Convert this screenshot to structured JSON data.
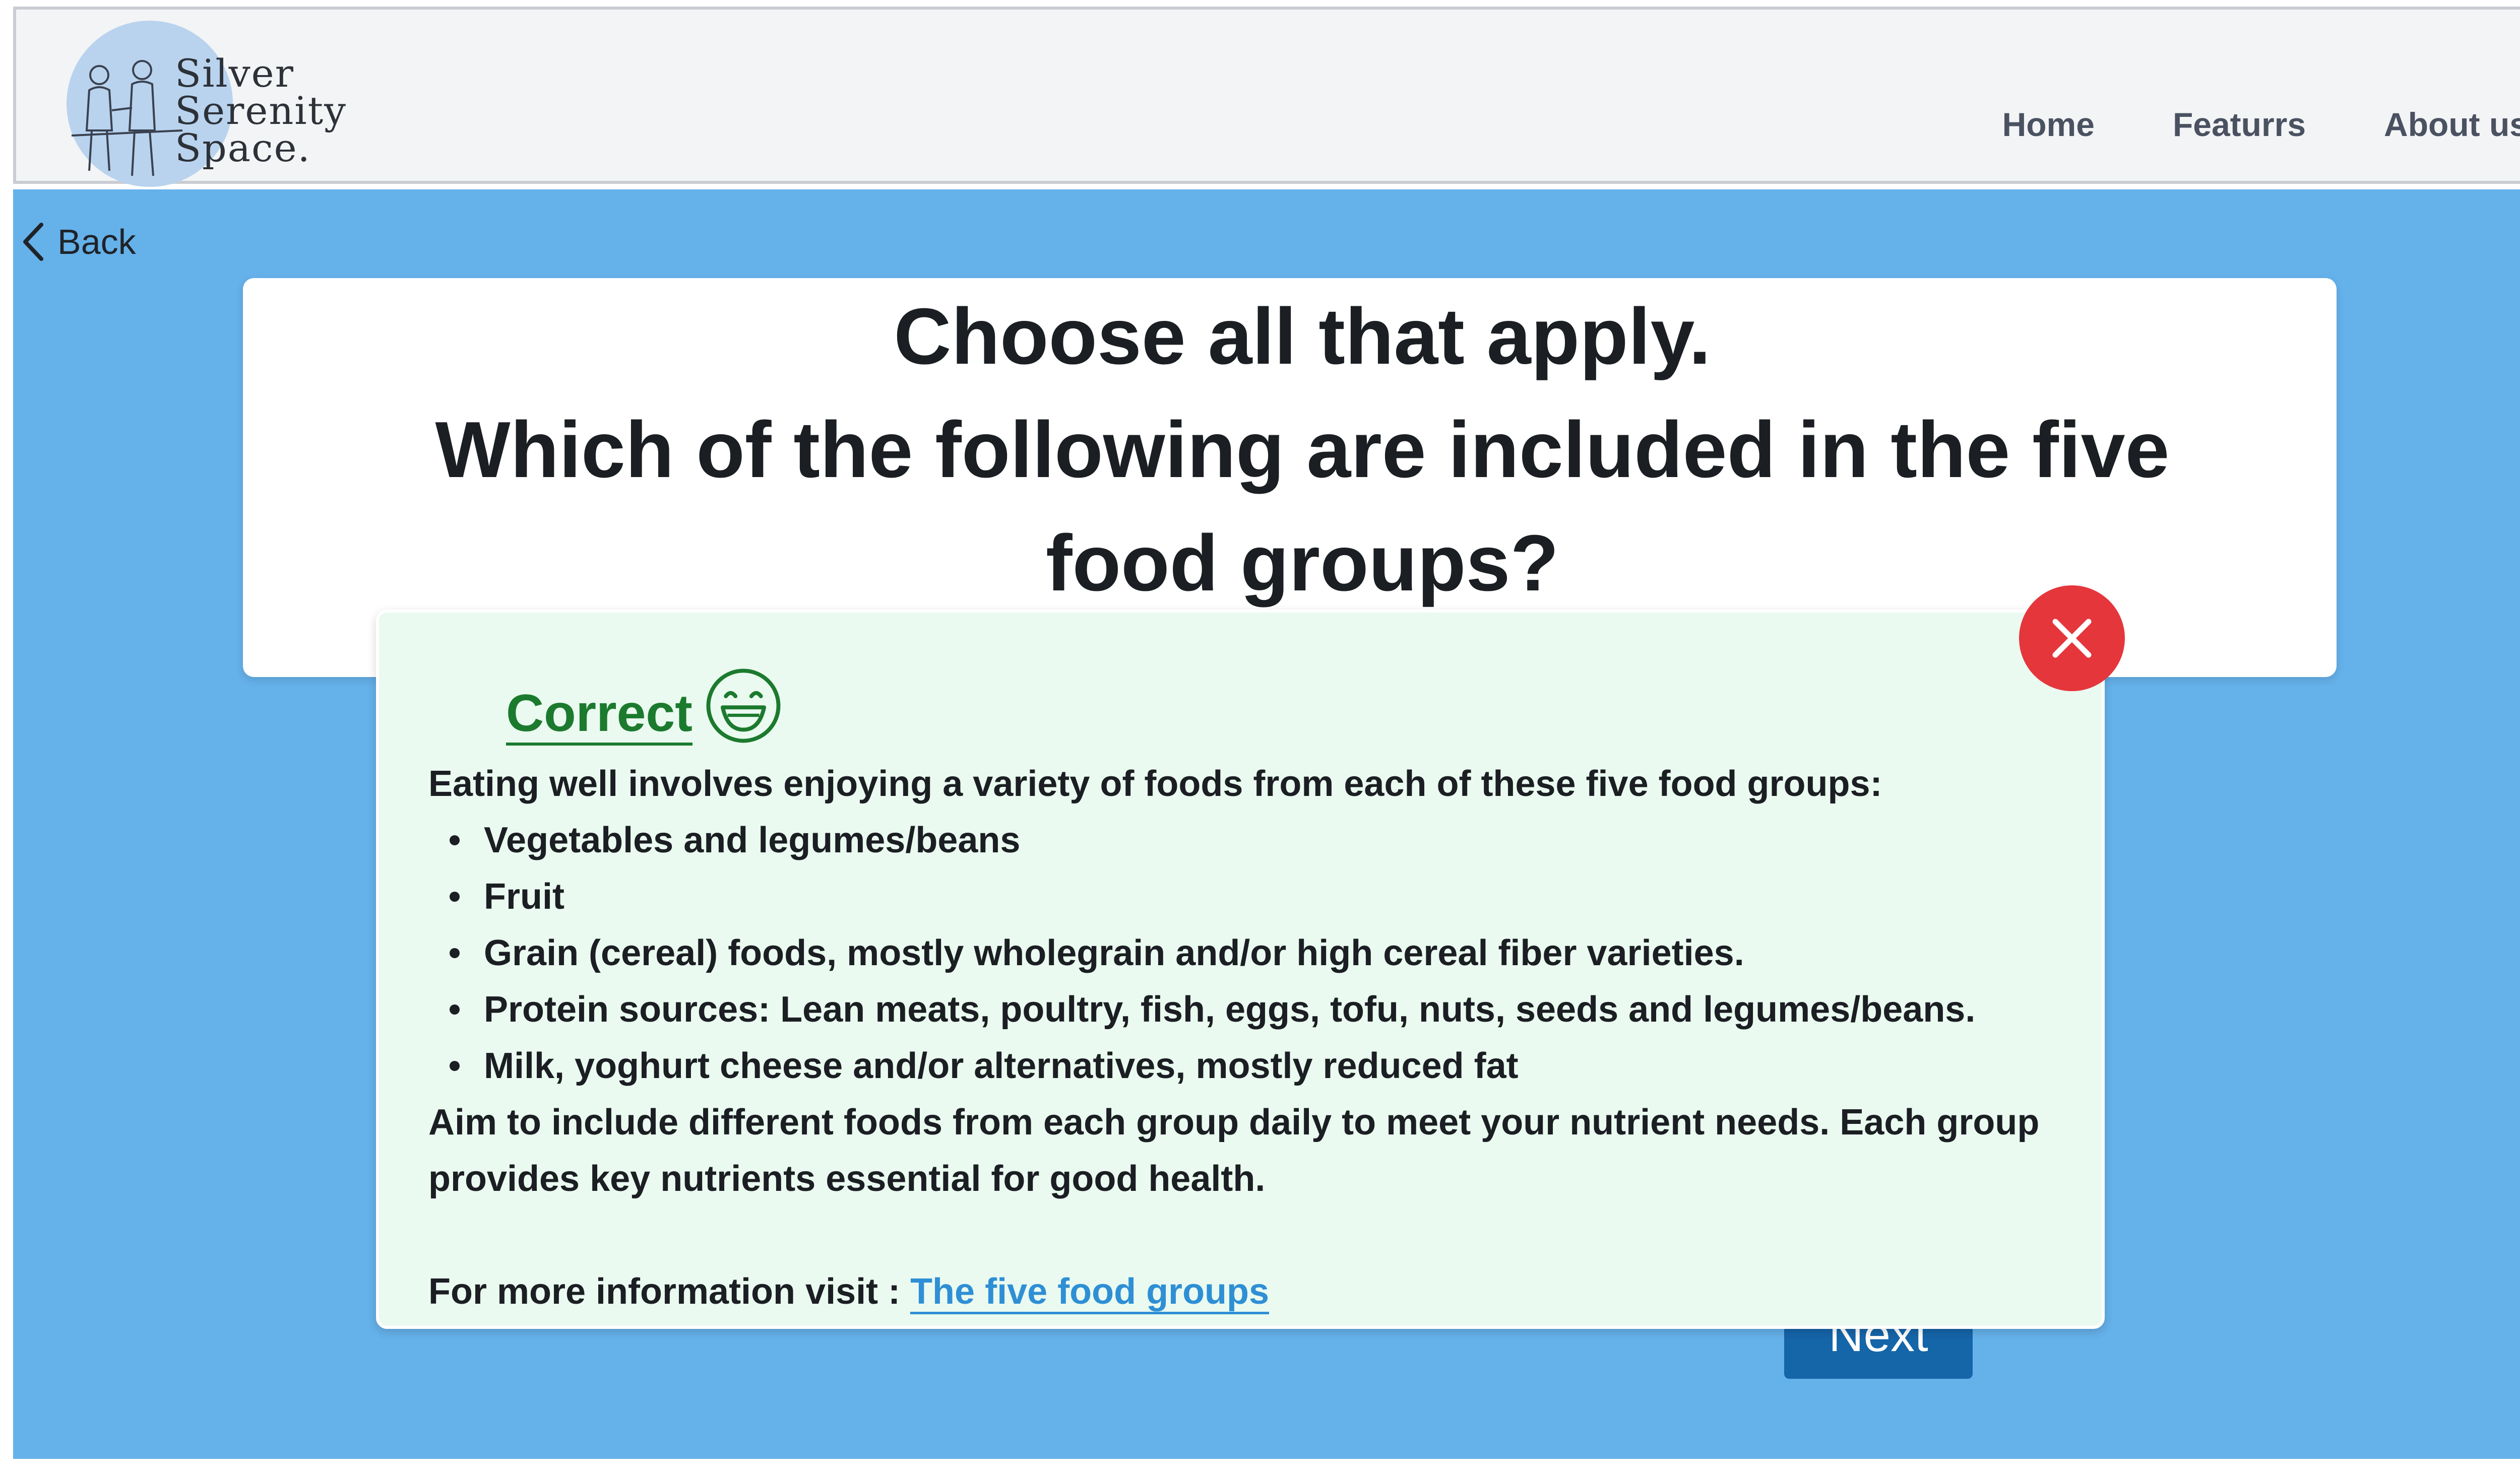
{
  "header": {
    "logo_lines": [
      "Silver",
      "Serenity",
      "Space."
    ],
    "nav": [
      {
        "label": "Home"
      },
      {
        "label": "Featurrs"
      },
      {
        "label": "About us"
      }
    ]
  },
  "back": {
    "label": "Back"
  },
  "question": {
    "line1": "Choose all that apply.",
    "line2": "Which of the following are included in the five",
    "line3": "food groups?"
  },
  "next_button": {
    "label": "Next"
  },
  "feedback": {
    "status": "Correct",
    "intro": "Eating well involves enjoying a variety of foods from each of these five food groups:",
    "items": [
      "Vegetables and legumes/beans",
      "Fruit",
      "Grain (cereal) foods, mostly wholegrain and/or high cereal fiber varieties.",
      "Protein sources: Lean meats, poultry, fish, eggs, tofu, nuts, seeds and legumes/beans.",
      "Milk, yoghurt cheese and/or alternatives, mostly reduced fat"
    ],
    "aim_line1": "Aim to include different foods from each group daily to meet your nutrient needs. Each group",
    "aim_line2": "provides key nutrients essential for good health.",
    "more_prefix": "For more information visit : ",
    "more_link": "The five food groups"
  },
  "colors": {
    "main_bg": "#65b1ea",
    "modal_bg": "#eafaf0",
    "correct_green": "#1c7a2e",
    "close_red": "#e5363c",
    "link_blue": "#2e8fd5",
    "next_button_bg": "#1565a9"
  },
  "icons": {
    "logo": "elderly-couple-logo",
    "back": "chevron-left-icon",
    "close": "close-icon",
    "status": "grinning-face-icon"
  }
}
